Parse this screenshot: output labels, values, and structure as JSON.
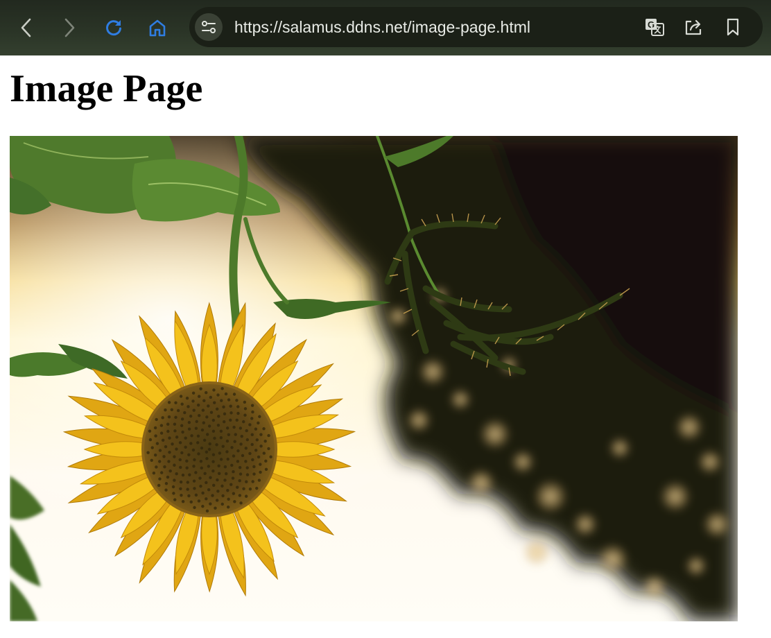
{
  "browser": {
    "url": "https://salamus.ddns.net/image-page.html",
    "icons": {
      "back": "back-arrow-icon",
      "forward": "forward-arrow-icon",
      "reload": "reload-icon",
      "home": "home-icon",
      "site_info": "site-info-icon",
      "translate": "translate-icon",
      "share": "share-icon",
      "bookmark": "bookmark-icon"
    },
    "colors": {
      "toolbar": "#2b3527",
      "address_bar": "#1b2017",
      "active_icon": "#2f7de1",
      "inactive_icon": "#b9beb5"
    }
  },
  "page": {
    "title": "Image Page",
    "image": {
      "subject": "sunflower-photo"
    }
  }
}
